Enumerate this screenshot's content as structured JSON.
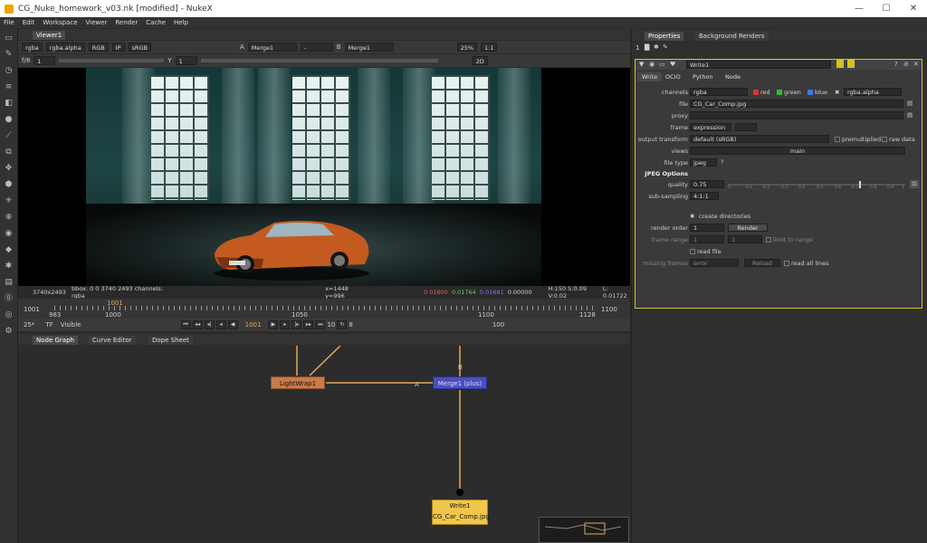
{
  "window": {
    "title": "CG_Nuke_homework_v03.nk [modified] - NukeX",
    "minimize": "—",
    "maximize": "☐",
    "close": "✕"
  },
  "menu": [
    "File",
    "Edit",
    "Workspace",
    "Viewer",
    "Render",
    "Cache",
    "Help"
  ],
  "viewer": {
    "tab": "Viewer1",
    "channels": "rgba",
    "alpha": "rgba.alpha",
    "rgb": "RGB",
    "ip": "IP",
    "colorspace": "sRGB",
    "a_label": "A",
    "a_input": "Merge1",
    "a_op": "-",
    "b_label": "B",
    "b_input": "Merge1",
    "zoom": "25%",
    "ratio": "1:1",
    "mode": "2D",
    "fstop": "f/8",
    "gain": "1",
    "y_label": "Y",
    "gamma": "1"
  },
  "status": {
    "res": "3740x2493",
    "bbox": "bbox: 0 0 3740 2493 channels: rgba",
    "coords": "x=1448 y=996",
    "r": "0.01600",
    "g": "0.01764",
    "b": "0.01681",
    "a": "0.00000",
    "hsv": "H:150 S:0.09 V:0.02",
    "l": "L: 0.01722"
  },
  "timeline": {
    "start": "1001",
    "current_marker": "1001",
    "end": "1100",
    "ticks": [
      "983",
      "1000",
      "1050",
      "1100",
      "1128"
    ],
    "fps_label": "25*",
    "tf": "TF",
    "visible": "Visible",
    "frame": "1001",
    "step": "10",
    "incr": "8",
    "count": "100"
  },
  "nodegraph": {
    "tabs": [
      "Node Graph",
      "Curve Editor",
      "Dope Sheet"
    ],
    "nodes": {
      "lightwrap": "LightWrap1",
      "merge": "Merge1 (plus)",
      "write": "Write1",
      "write_file": "CG_Car_Comp.jpg"
    },
    "input_a": "A",
    "input_b": "B"
  },
  "properties": {
    "tabs": [
      "Properties",
      "Background Renders"
    ],
    "count": "1",
    "node_name": "Write1",
    "subtabs": [
      "Write",
      "OCIO",
      "Python",
      "Node"
    ],
    "channels_label": "channels",
    "channels": "rgba",
    "ch_red": "red",
    "ch_green": "green",
    "ch_blue": "blue",
    "ch_alpha": "rgba.alpha",
    "file_label": "file",
    "file": "CG_Car_Comp.jpg",
    "proxy_label": "proxy",
    "frame_label": "frame",
    "frame": "expression",
    "ot_label": "output transform",
    "ot": "default (sRGB)",
    "premult": "premultiplied",
    "raw": "raw data",
    "views_label": "views",
    "views": "main",
    "filetype_label": "file type",
    "filetype": "jpeg",
    "jpeg_header": "JPEG Options",
    "quality_label": "quality",
    "quality": "0.75",
    "quality_ticks": [
      "0",
      "0.1",
      "0.2",
      "0.3",
      "0.4",
      "0.5",
      "0.6",
      "0.7",
      "0.8",
      "0.9",
      "1"
    ],
    "subsampling_label": "sub-sampling",
    "subsampling": "4:1:1",
    "create_dirs": "create directories",
    "render_order_label": "render order",
    "render_order": "1",
    "render_btn": "Render",
    "frame_range_label": "frame range",
    "fr_start": "1",
    "fr_end": "1",
    "limit": "limit to range",
    "read_file": "read file",
    "missing_label": "missing frames",
    "missing": "error",
    "reload": "Reload",
    "read_all": "read all lines"
  },
  "colors": {
    "lightwrap": "#c97a4a",
    "merge": "#4a4ec0",
    "write": "#f2c64b",
    "wire": "#e3a85a",
    "accent": "#d6c11e"
  }
}
